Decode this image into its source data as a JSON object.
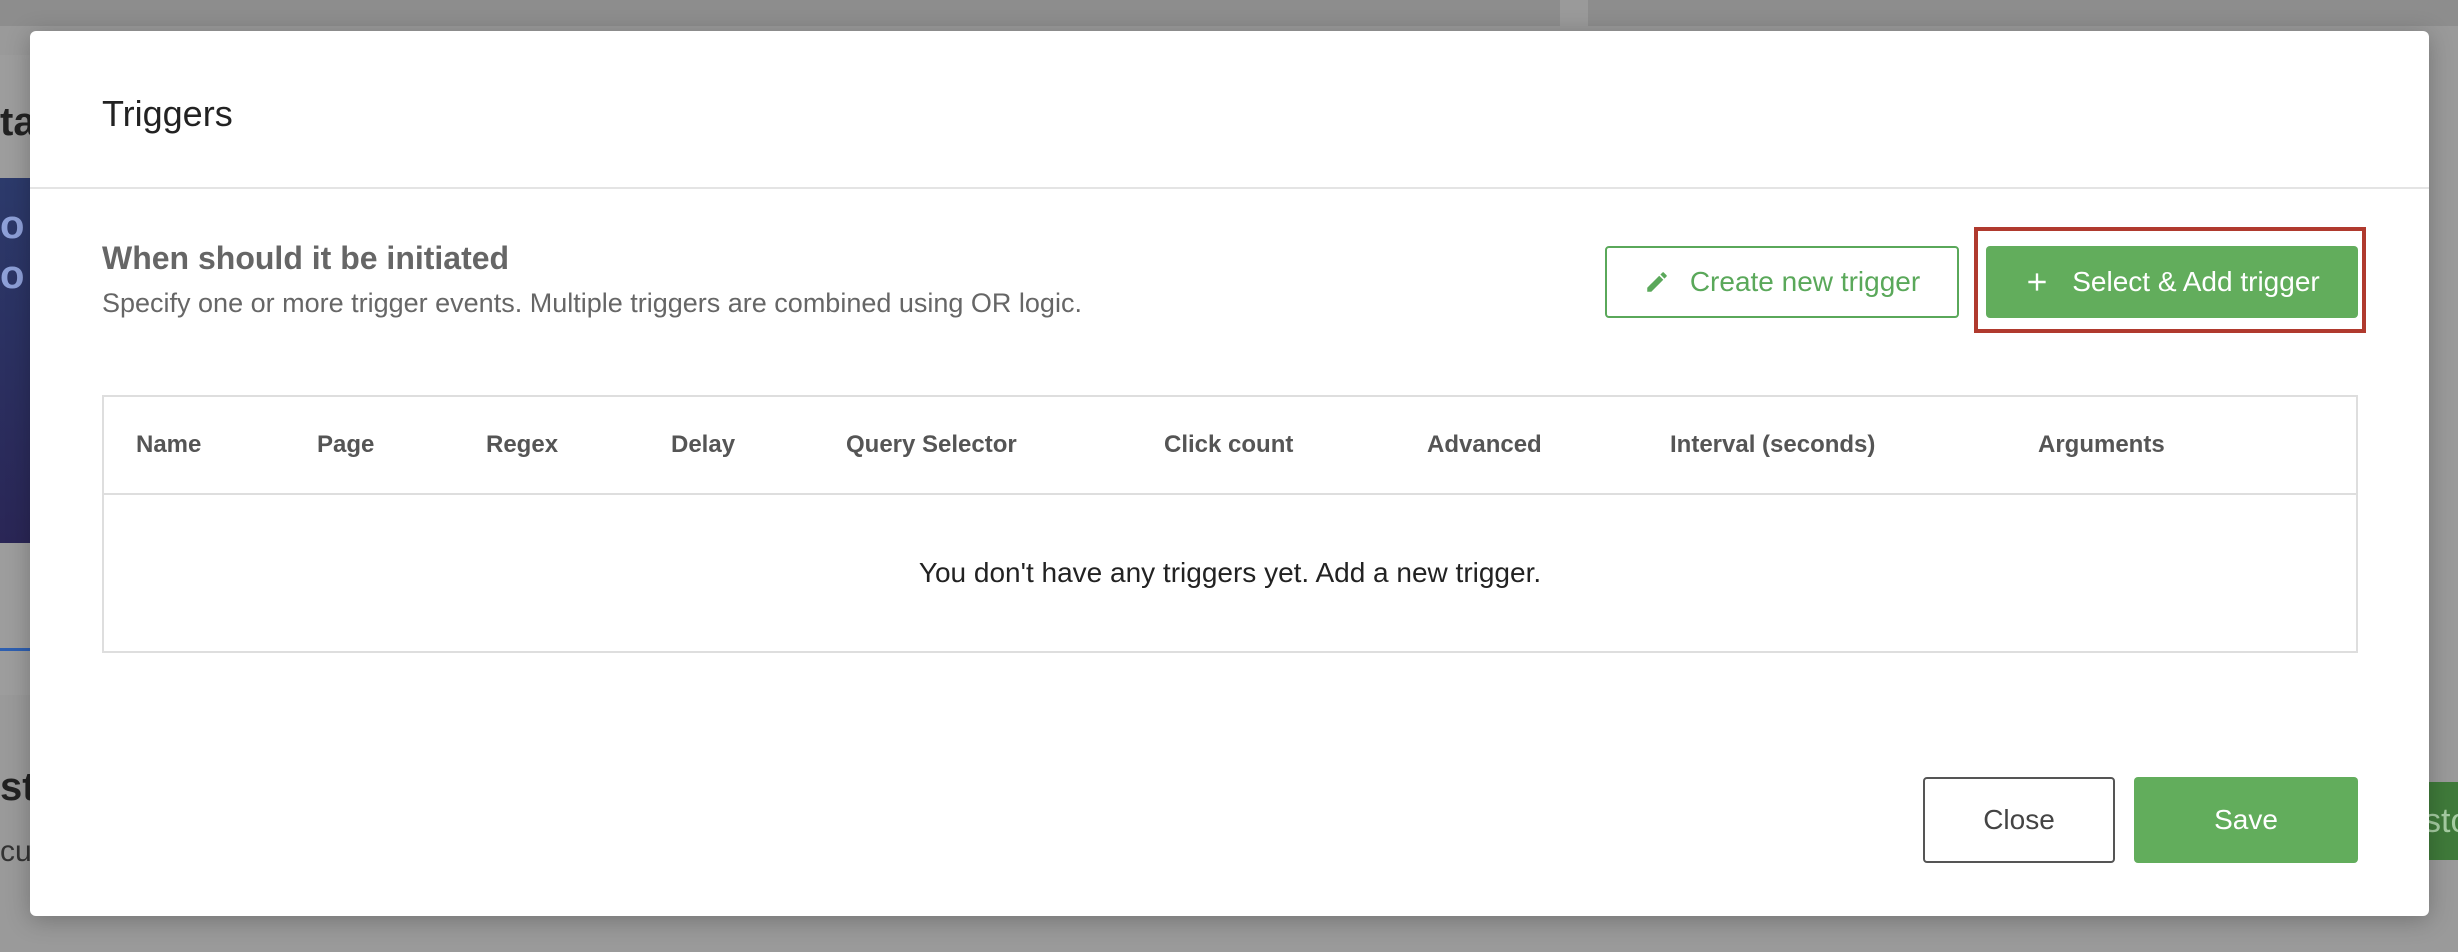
{
  "modal": {
    "title": "Triggers",
    "section_title": "When should it be initiated",
    "section_desc": "Specify one or more trigger events. Multiple triggers are combined using OR logic.",
    "create_button": "Create new trigger",
    "create_icon": "pencil-icon",
    "select_button": "Select & Add trigger",
    "select_icon": "plus-icon",
    "table": {
      "columns": [
        "Name",
        "Page",
        "Regex",
        "Delay",
        "Query Selector",
        "Click count",
        "Advanced",
        "Interval (seconds)",
        "Arguments"
      ],
      "empty_message": "You don't have any triggers yet. Add a new trigger."
    },
    "close_button": "Close",
    "save_button": "Save"
  },
  "background": {
    "heading_fragment": "ta",
    "banner_fragment": "o\no",
    "heading2_fragment": "st",
    "sub2_fragment": "cu",
    "right_button_fragment": "sto"
  },
  "colors": {
    "accent_green": "#62ad5c",
    "highlight_red": "#b03a2e"
  }
}
